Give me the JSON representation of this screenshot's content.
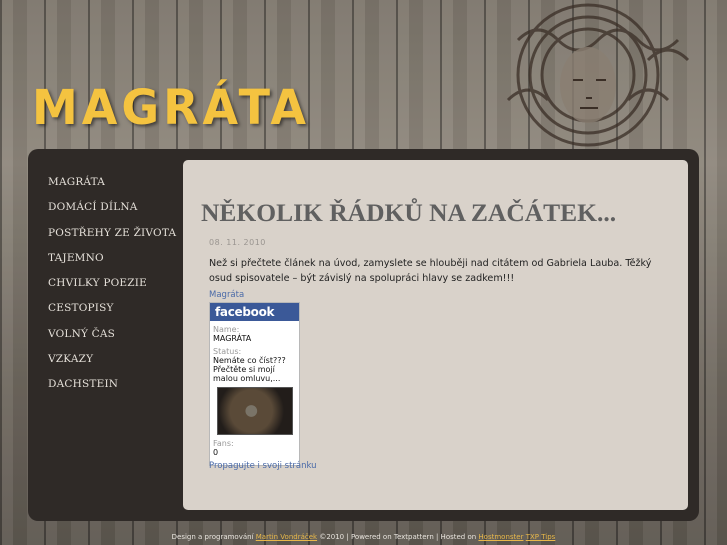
{
  "header": {
    "logo_text": "MAGRÁTA"
  },
  "menu": {
    "items": [
      "MAGRÁTA",
      "DOMÁCÍ DÍLNA",
      "POSTŘEHY ZE ŽIVOTA",
      "TAJEMNO",
      "CHVILKY POEZIE",
      "CESTOPISY",
      "VOLNÝ ČAS",
      "VZKAZY",
      "DACHSTEIN"
    ]
  },
  "article": {
    "title": "NĚKOLIK ŘÁDKŮ NA ZAČÁTEK...",
    "date": "08. 11. 2010",
    "body": "Než si přečtete článek na úvod, zamyslete se hlouběji nad citátem od Gabriela Lauba. Těžký osud spisovatele – být závislý na spolupráci hlavy se zadkem!!!"
  },
  "facebook": {
    "top_link": "Magráta",
    "brand": "facebook",
    "name_label": "Name:",
    "name_value": "MAGRÁTA",
    "status_label": "Status:",
    "status_value": "Nemáte co číst???Přečtěte si mojí malou omluvu,...",
    "fans_label": "Fans:",
    "fans_value": "0",
    "promote_link": "Propagujte i svoji stránku"
  },
  "footer": {
    "text1": "Design a programování ",
    "author": "Martin Vondráček",
    "text2": " ©2010 | Powered on Textpattern | Hosted on ",
    "host": "Hostmonster",
    "tips": "TXP Tips"
  },
  "colors": {
    "logo": "#f4c340",
    "panel": "#2f2a27",
    "content": "#d9d2ca",
    "facebook": "#3b5998",
    "link": "#4a6aa8"
  }
}
